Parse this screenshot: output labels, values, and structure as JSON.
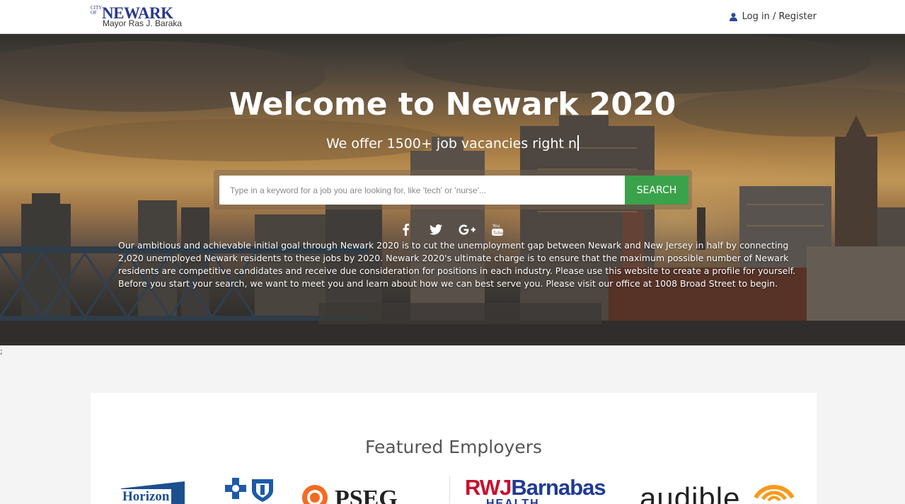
{
  "header": {
    "logo": {
      "city": "CITY OF",
      "name": "NEWARK",
      "mayor": "Mayor Ras J. Baraka"
    },
    "login_label": "Log in / Register",
    "login_icon": "user-icon"
  },
  "hero": {
    "title": "Welcome to Newark 2020",
    "subtitle": "We offer 1500+ job vacancies right n",
    "search": {
      "placeholder": "Type in a keyword for a job you are looking for, like 'tech' or 'nurse'...",
      "value": "",
      "button_label": "SEARCH"
    },
    "social": [
      "facebook-icon",
      "twitter-icon",
      "google-plus-icon",
      "youtube-icon"
    ],
    "description": "Our ambitious and achievable initial goal through Newark 2020 is to cut the unemployment gap between Newark and New Jersey in half by connecting 2,020 unemployed Newark residents to these jobs by 2020. Newark 2020's ultimate charge is to ensure that the maximum possible number of Newark residents are competitive candidates and receive due consideration for positions in each industry. Please use this website to create a profile for yourself. Before you start your search, we want to meet you and learn about how we can best serve you. Please visit our office at 1008 Broad Street to begin."
  },
  "stray_text": ";",
  "featured": {
    "title": "Featured Employers",
    "employers": {
      "horizon": "Horizon",
      "pseg": "PSEG",
      "rwj_red": "RWJ",
      "rwj_blue": "Barnabas",
      "rwj_sub": "HEALTH",
      "audible": "audible"
    }
  },
  "colors": {
    "accent_green": "#3aa24a",
    "newark_blue": "#2b3a8c",
    "rwj_red": "#c8102e",
    "rwj_blue": "#1f3a93",
    "audible_orange": "#f7991c"
  }
}
